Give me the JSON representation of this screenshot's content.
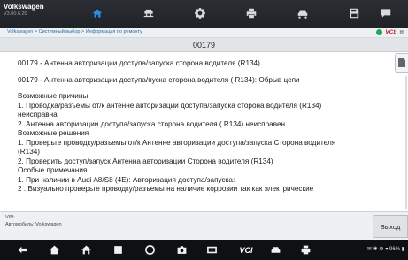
{
  "app": {
    "brand": "Volkswagen",
    "version": "V3.00.6.20"
  },
  "toolbar": {
    "buttons": [
      {
        "icon": "home-icon"
      },
      {
        "icon": "car-lift-icon"
      },
      {
        "icon": "settings-icon"
      },
      {
        "icon": "print-icon"
      },
      {
        "icon": "car-icon"
      },
      {
        "icon": "save-icon"
      },
      {
        "icon": "chat-icon"
      }
    ]
  },
  "breadcrumb": "Volkswagen > Системный выбор > Информация по ремонту",
  "vci": {
    "label": "VCb"
  },
  "dtc": {
    "code": "00179"
  },
  "content": {
    "lines": [
      "00179 - Антенна авторизации доступа/запуска сторона водителя (R134)",
      "",
      "00179 - Антенна авторизации доступа/пуска сторона водителя ( R134): Обрыв цепи",
      "",
      "Возможные причины",
      "1. Проводка/разъемы от/к антенне авторизации доступа/запуска сторона водителя (R134)",
      "неисправна",
      "2. Антенна авторизации доступа/запуска сторона водителя ( R134) неисправен",
      "Возможные решения",
      "1. Проверьте проводку/разъемы от/к Антенне авторизации доступа/запуска Сторона водителя",
      "(R134)",
      "2. Проверить доступ/запуск Антенна авторизации Сторона водителя (R134)",
      "Особые примечания",
      "1. При наличии в Audi A8/S8 (4E): Авторизация доступа/запуска:",
      "2 . Визуально проверьте проводку/разъемы на наличие коррозии так как электрические"
    ]
  },
  "footer": {
    "vin": "VIN:",
    "car": "Автомобиль: Volkswagen",
    "exit": "Выход"
  },
  "navbar": {
    "vci_text": "VCI",
    "status": "✉ ✱ ⚙ ▾ 96% ▮"
  }
}
